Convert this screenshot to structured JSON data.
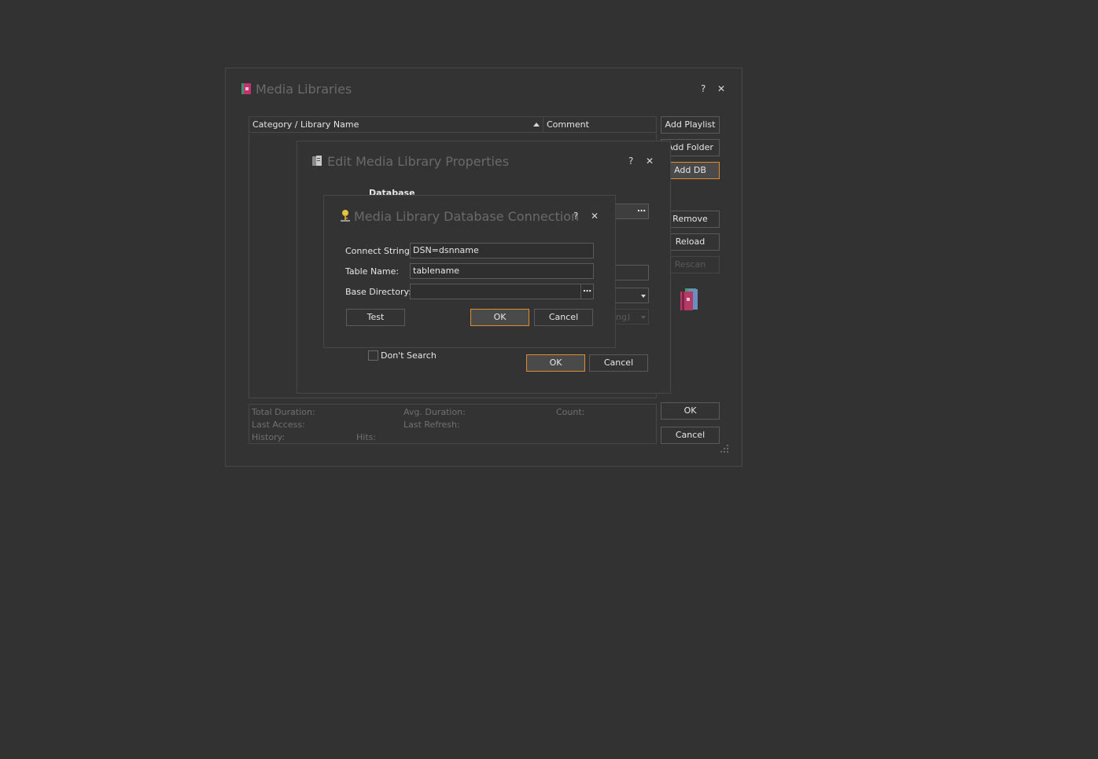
{
  "media_libraries": {
    "title": "Media Libraries",
    "help": "?",
    "close": "✕",
    "columns": {
      "name": "Category / Library Name",
      "comment": "Comment"
    },
    "buttons": {
      "add_playlist": "Add Playlist",
      "add_folder": "Add Folder",
      "add_db": "Add DB",
      "remove": "Remove",
      "reload": "Reload",
      "rescan": "Rescan",
      "ok": "OK",
      "cancel": "Cancel"
    },
    "stats": {
      "total_duration": "Total Duration:",
      "avg_duration": "Avg. Duration:",
      "count": "Count:",
      "last_access": "Last Access:",
      "last_refresh": "Last Refresh:",
      "history": "History:",
      "hits": "Hits:"
    }
  },
  "edit_props": {
    "title": "Edit Media Library Properties",
    "help": "?",
    "close": "✕",
    "section": "Database",
    "partial_field": "ng)",
    "dont_search": "Don't Search",
    "ok": "OK",
    "cancel": "Cancel",
    "dots": "⋯"
  },
  "db_conn": {
    "title": "Media Library Database Connection",
    "help": "?",
    "close": "✕",
    "connect_label": "Connect String:",
    "connect_value": "DSN=dsnname",
    "table_label": "Table Name:",
    "table_value": "tablename",
    "base_label": "Base Directory:",
    "base_value": "",
    "dots": "⋯",
    "test": "Test",
    "ok": "OK",
    "cancel": "Cancel"
  },
  "colors": {
    "accent": "#e08c34",
    "bg": "#323232",
    "border": "#474747"
  }
}
